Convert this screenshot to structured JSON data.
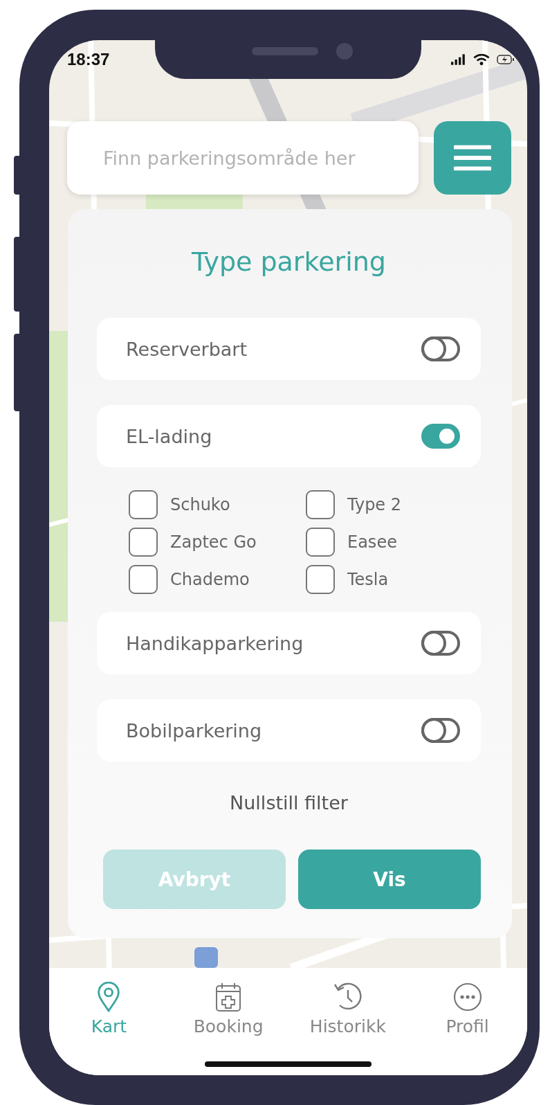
{
  "status_bar": {
    "time": "18:37"
  },
  "search": {
    "placeholder": "Finn parkeringsområde her"
  },
  "filter_panel": {
    "title": "Type parkering",
    "options": [
      {
        "label": "Reserverbart",
        "on": false
      },
      {
        "label": "EL-lading",
        "on": true,
        "connectors": [
          {
            "label": "Schuko",
            "checked": false
          },
          {
            "label": "Type 2",
            "checked": false
          },
          {
            "label": "Zaptec Go",
            "checked": false
          },
          {
            "label": "Easee",
            "checked": false
          },
          {
            "label": "Chademo",
            "checked": false
          },
          {
            "label": "Tesla",
            "checked": false
          }
        ]
      },
      {
        "label": "Handikapparkering",
        "on": false
      },
      {
        "label": "Bobilparkering",
        "on": false
      }
    ],
    "reset_link": "Nullstill filter",
    "buttons": [
      {
        "label": "Avbryt",
        "kind": "secondary"
      },
      {
        "label": "Vis",
        "kind": "primary"
      }
    ]
  },
  "tab_bar": [
    {
      "label": "Kart",
      "selected": true
    },
    {
      "label": "Booking",
      "selected": false
    },
    {
      "label": "Historikk",
      "selected": false
    },
    {
      "label": "Profil",
      "selected": false
    }
  ]
}
